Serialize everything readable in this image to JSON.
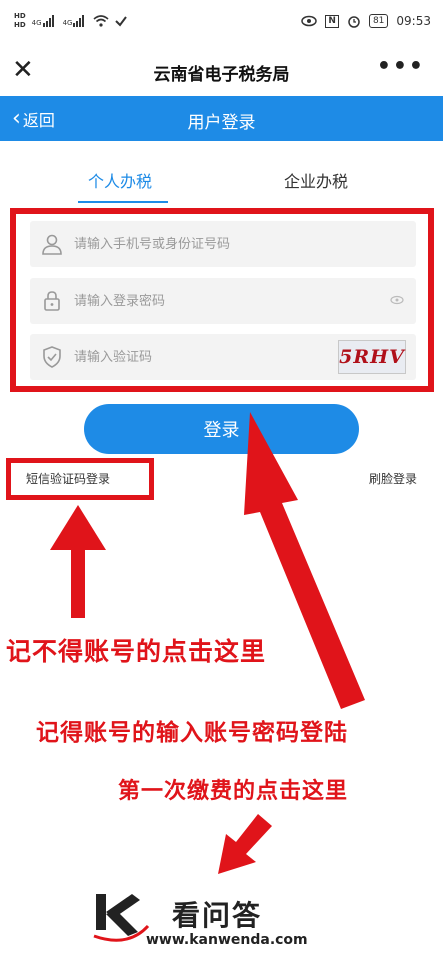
{
  "status_bar": {
    "network_left": "HD",
    "network_left2": "HD",
    "signal1": "4G",
    "signal2": "4G",
    "nfc": "N",
    "battery": "81",
    "time": "09:53"
  },
  "title_bar": {
    "title": "云南省电子税务局"
  },
  "header": {
    "back_label": "返回",
    "title": "用户登录"
  },
  "tabs": [
    {
      "label": "个人办税",
      "active": true
    },
    {
      "label": "企业办税",
      "active": false
    }
  ],
  "form": {
    "phone_placeholder": "请输入手机号或身份证号码",
    "password_placeholder": "请输入登录密码",
    "code_placeholder": "请输入验证码",
    "captcha_text": "5RHV"
  },
  "login_button": "登录",
  "sms_login": "短信验证码登录",
  "face_login": "刷脸登录",
  "annotations": {
    "forgot_account": "记不得账号的点击这里",
    "remember_account": "记得账号的输入账号密码登陆",
    "first_payment": "第一次缴费的点击这里"
  },
  "watermark": {
    "name": "看问答",
    "url": "www.kanwenda.com"
  },
  "colors": {
    "brand_blue": "#1e8be6",
    "annotation_red": "#e0141a"
  },
  "icons": [
    "wifi-icon",
    "eye-icon",
    "alarm-icon",
    "close-icon",
    "more-icon",
    "back-chevron-icon",
    "user-icon",
    "lock-icon",
    "shield-icon",
    "eye-closed-icon"
  ]
}
